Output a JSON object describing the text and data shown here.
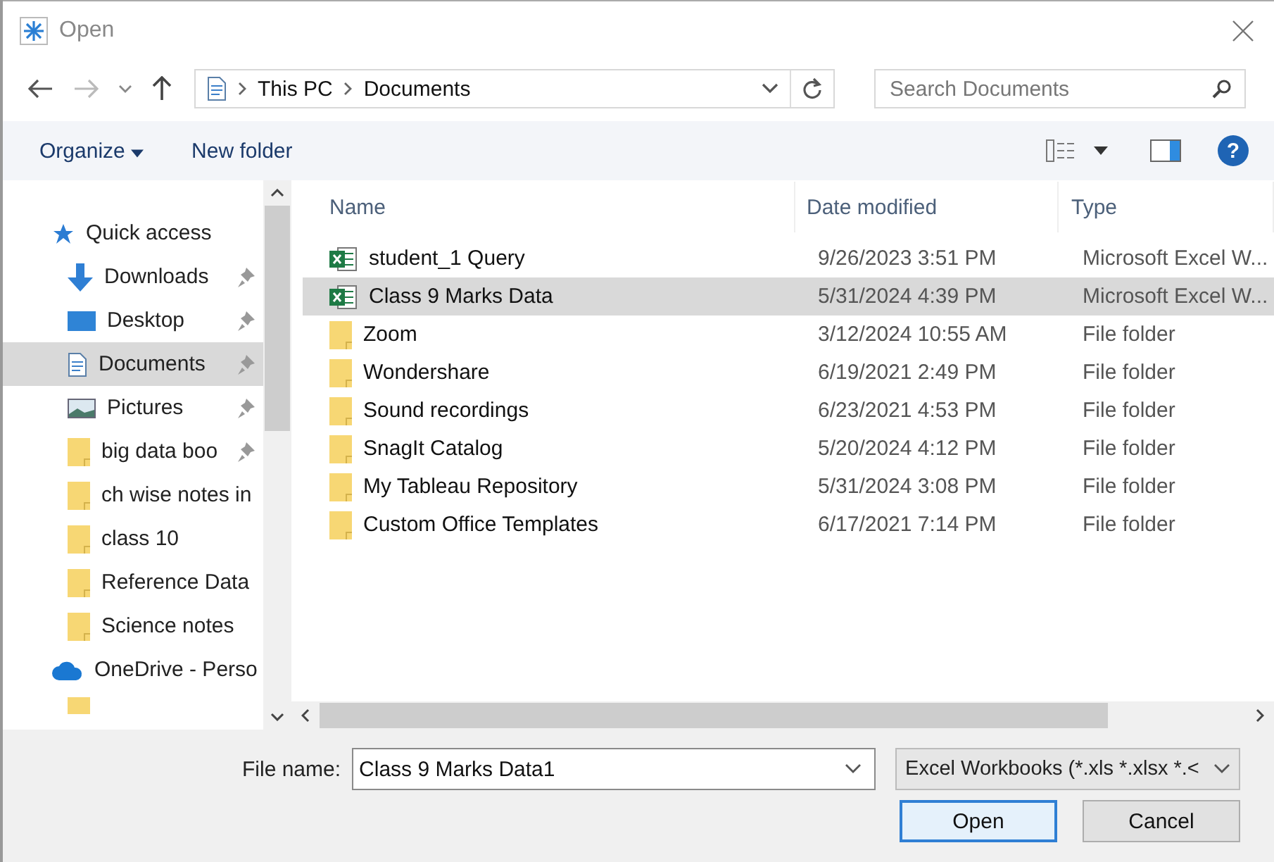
{
  "window": {
    "title": "Open"
  },
  "nav": {
    "path": [
      "This PC",
      "Documents"
    ],
    "search_placeholder": "Search Documents"
  },
  "toolbar": {
    "organize": "Organize",
    "new_folder": "New folder",
    "help": "?"
  },
  "sidebar": {
    "items": [
      {
        "label": "Quick access",
        "kind": "quick-access",
        "pinned": false,
        "selected": false
      },
      {
        "label": "Downloads",
        "kind": "downloads",
        "pinned": true,
        "selected": false
      },
      {
        "label": "Desktop",
        "kind": "desktop",
        "pinned": true,
        "selected": false
      },
      {
        "label": "Documents",
        "kind": "documents",
        "pinned": true,
        "selected": true
      },
      {
        "label": "Pictures",
        "kind": "pictures",
        "pinned": true,
        "selected": false
      },
      {
        "label": "big data boo",
        "kind": "folder",
        "pinned": true,
        "selected": false
      },
      {
        "label": "ch wise notes in",
        "kind": "folder",
        "pinned": false,
        "selected": false
      },
      {
        "label": "class 10",
        "kind": "folder",
        "pinned": false,
        "selected": false
      },
      {
        "label": "Reference Data",
        "kind": "folder",
        "pinned": false,
        "selected": false
      },
      {
        "label": "Science notes",
        "kind": "folder",
        "pinned": false,
        "selected": false
      },
      {
        "label": "OneDrive - Perso",
        "kind": "onedrive",
        "pinned": false,
        "selected": false
      }
    ]
  },
  "table": {
    "columns": [
      "Name",
      "Date modified",
      "Type"
    ],
    "rows": [
      {
        "name": "student_1 Query",
        "date": "9/26/2023 3:51 PM",
        "type": "Microsoft Excel W...",
        "kind": "excel",
        "selected": false
      },
      {
        "name": "Class 9 Marks Data",
        "date": "5/31/2024 4:39 PM",
        "type": "Microsoft Excel W...",
        "kind": "excel",
        "selected": true
      },
      {
        "name": "Zoom",
        "date": "3/12/2024 10:55 AM",
        "type": "File folder",
        "kind": "folder",
        "selected": false
      },
      {
        "name": "Wondershare",
        "date": "6/19/2021 2:49 PM",
        "type": "File folder",
        "kind": "folder",
        "selected": false
      },
      {
        "name": "Sound recordings",
        "date": "6/23/2021 4:53 PM",
        "type": "File folder",
        "kind": "folder",
        "selected": false
      },
      {
        "name": "SnagIt Catalog",
        "date": "5/20/2024 4:12 PM",
        "type": "File folder",
        "kind": "folder",
        "selected": false
      },
      {
        "name": "My Tableau Repository",
        "date": "5/31/2024 3:08 PM",
        "type": "File folder",
        "kind": "folder",
        "selected": false
      },
      {
        "name": "Custom Office Templates",
        "date": "6/17/2021 7:14 PM",
        "type": "File folder",
        "kind": "folder",
        "selected": false
      }
    ]
  },
  "footer": {
    "file_name_label": "File name:",
    "file_name": "Class 9 Marks Data1",
    "file_type": "Excel Workbooks (*.xls *.xlsx *.<",
    "buttons": [
      "Open",
      "Cancel"
    ]
  }
}
